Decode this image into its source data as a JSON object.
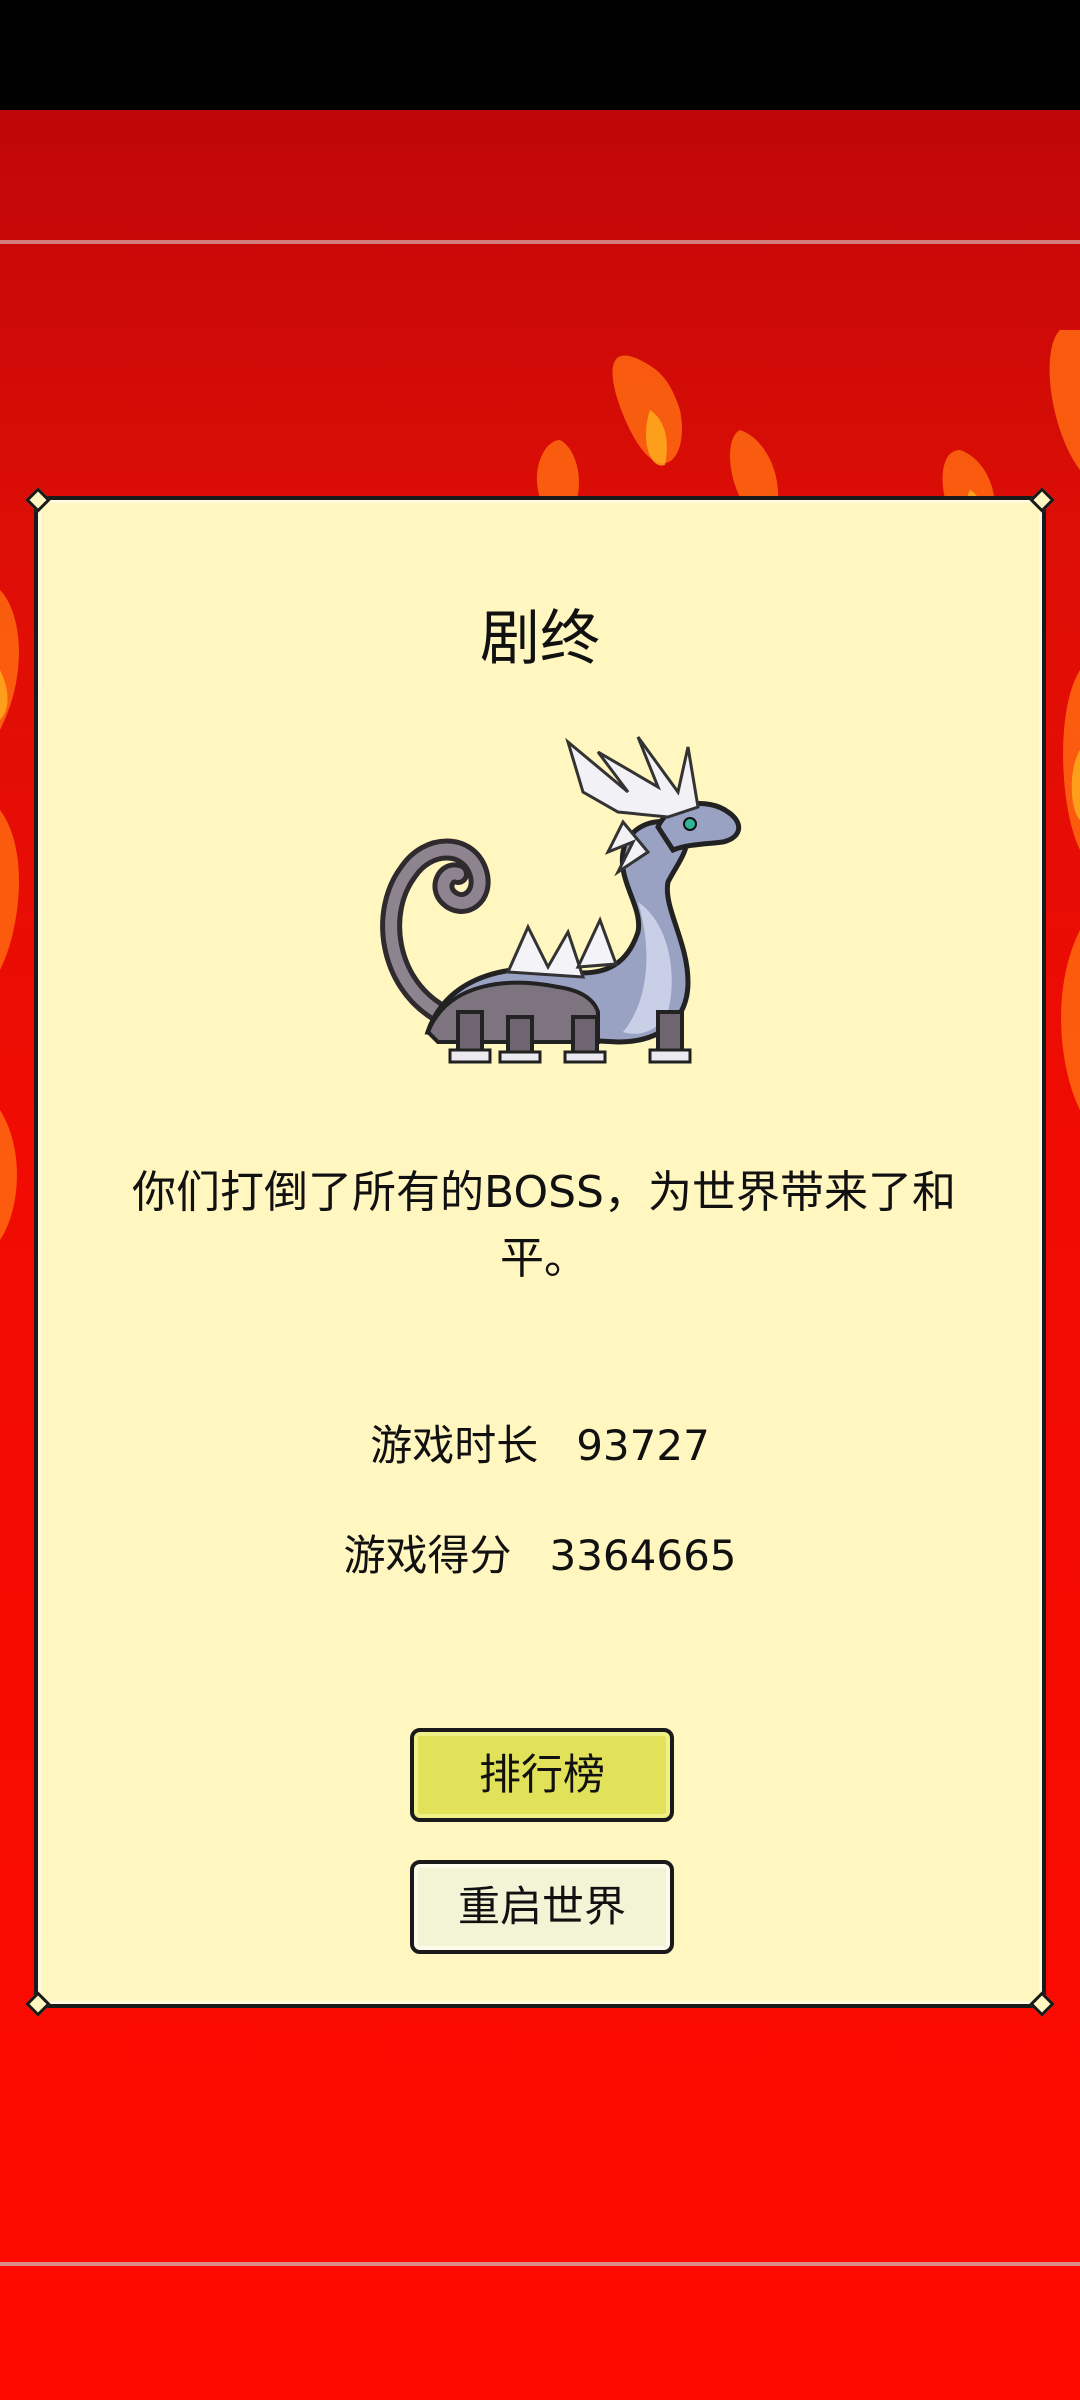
{
  "dialog": {
    "title": "剧终",
    "message": "你们打倒了所有的BOSS，为世界带来了和平。",
    "stats": {
      "time_label": "游戏时长",
      "time_value": "93727",
      "score_label": "游戏得分",
      "score_value": "3364665"
    },
    "buttons": {
      "leaderboard": "排行榜",
      "restart": "重启世界"
    }
  },
  "colors": {
    "background": "#ff0000",
    "dialog_bg": "#fff6c0",
    "leaderboard_button": "#e2e25a",
    "restart_button": "#f3f3d6"
  },
  "images": {
    "boss": "white-dragon-boss"
  }
}
